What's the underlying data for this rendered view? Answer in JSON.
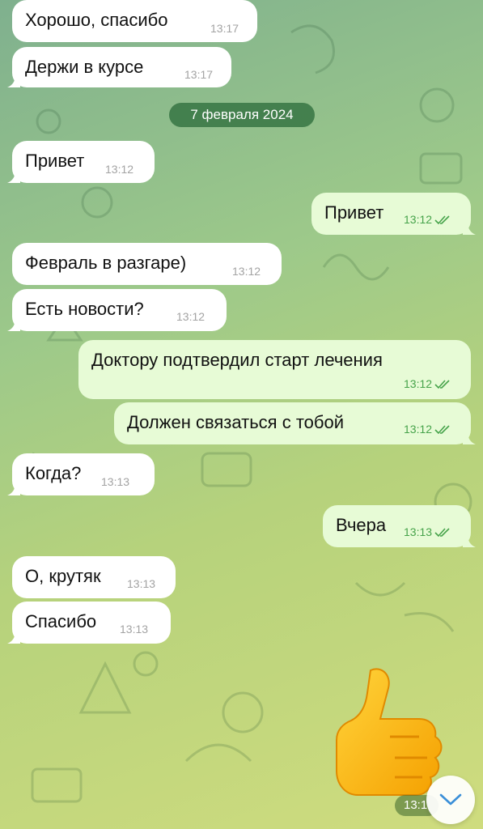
{
  "chat": {
    "date_separator": "7 февраля 2024",
    "messages": [
      {
        "text": "Хорошо, спасибо",
        "time": "13:17"
      },
      {
        "text": "Держи в курсе",
        "time": "13:17"
      },
      {
        "text": "Привет",
        "time": "13:12"
      },
      {
        "text": "Привет",
        "time": "13:12"
      },
      {
        "text": "Февраль в разгаре)",
        "time": "13:12"
      },
      {
        "text": "Есть новости?",
        "time": "13:12"
      },
      {
        "text": "Доктору подтвердил старт лечения",
        "time": "13:12"
      },
      {
        "text": "Должен связаться с тобой",
        "time": "13:12"
      },
      {
        "text": "Когда?",
        "time": "13:13"
      },
      {
        "text": "Вчера",
        "time": "13:13"
      },
      {
        "text": "О, крутяк",
        "time": "13:13"
      },
      {
        "text": "Спасибо",
        "time": "13:13"
      }
    ],
    "sticker": {
      "emoji": "thumbs-up",
      "time": "13:1"
    }
  },
  "colors": {
    "incoming_bubble": "#ffffff",
    "outgoing_bubble": "#e7fbd6",
    "read_tick": "#46a34a"
  },
  "icons": {
    "read_receipt": "double-check-icon",
    "scroll_down": "chevron-down-icon"
  }
}
